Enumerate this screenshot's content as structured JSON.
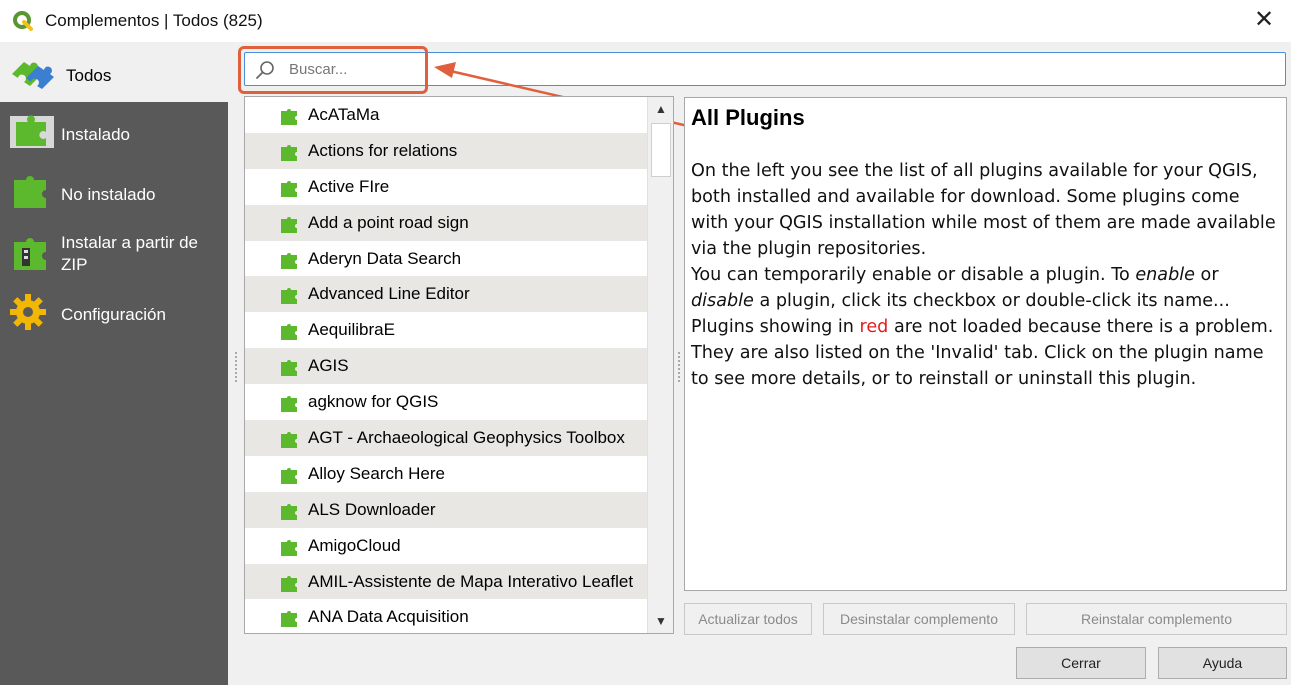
{
  "window": {
    "title": "Complementos | Todos (825)",
    "close_glyph": "✕"
  },
  "sidebar": {
    "items": [
      {
        "label": "Todos",
        "icon": "all-plugins-icon"
      },
      {
        "label": "Instalado",
        "icon": "installed-plugins-icon"
      },
      {
        "label": "No instalado",
        "icon": "not-installed-plugins-icon"
      },
      {
        "label": "Instalar a partir de ZIP",
        "icon": "install-zip-icon"
      },
      {
        "label": "Configuración",
        "icon": "settings-gear-icon"
      }
    ]
  },
  "search": {
    "placeholder": "Buscar...",
    "value": ""
  },
  "plugins": [
    "AcATaMa",
    "Actions for relations",
    "Active FIre",
    "Add a point road sign",
    "Aderyn Data Search",
    "Advanced Line Editor",
    "AequilibraE",
    "AGIS",
    "agknow for QGIS",
    "AGT - Archaeological Geophysics Toolbox",
    "Alloy Search Here",
    "ALS Downloader",
    "AmigoCloud",
    "AMIL-Assistente de Mapa Interativo Leaflet",
    "ANA Data Acquisition"
  ],
  "description": {
    "title": "All Plugins",
    "para1": "On the left you see the list of all plugins available for your QGIS, both installed and available for download. Some plugins come with your QGIS installation while most of them are made available via the plugin repositories.",
    "para2_a": "You can temporarily enable or disable a plugin. To ",
    "para2_enable": "enable",
    "para2_b": " or ",
    "para2_disable": "disable",
    "para2_c": " a plugin, click its checkbox or double-click its name...",
    "para3_a": "Plugins showing in ",
    "para3_red": "red",
    "para3_b": " are not loaded because there is a problem. They are also listed on the 'Invalid' tab. Click on the plugin name to see more details, or to reinstall or uninstall this plugin."
  },
  "buttons": {
    "update_all": "Actualizar todos",
    "uninstall": "Desinstalar complemento",
    "reinstall": "Reinstalar complemento",
    "close": "Cerrar",
    "help": "Ayuda"
  },
  "colors": {
    "sidebar_bg": "#595959",
    "search_border": "#4a90d9",
    "highlight": "#e0603d",
    "plugin_green": "#5cb82c"
  }
}
